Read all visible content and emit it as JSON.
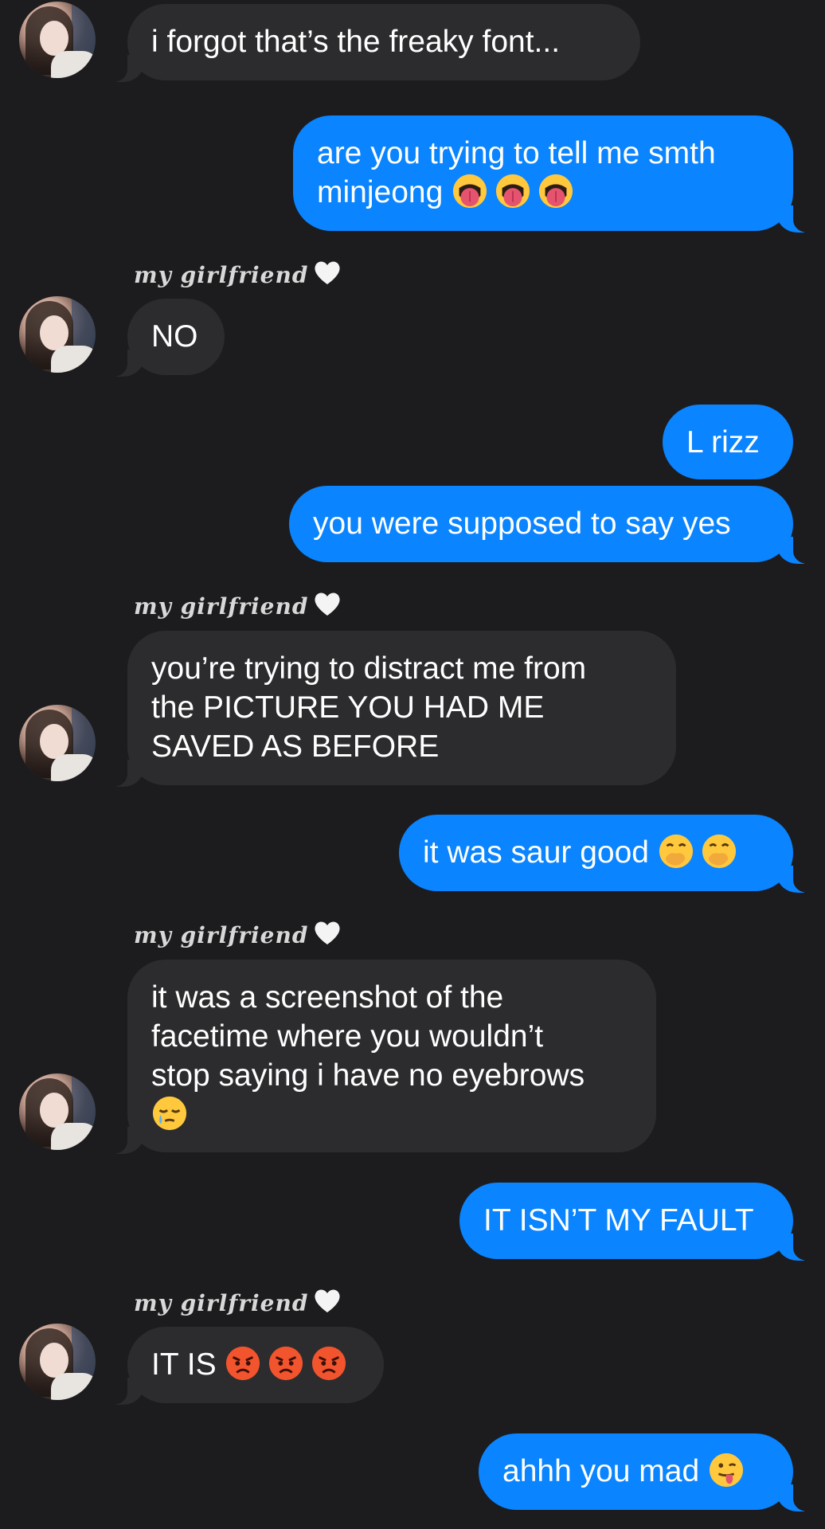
{
  "conversation": {
    "sender_name": "my girlfriend",
    "sender_emoji_icon": "white-heart-icon",
    "messages": [
      {
        "id": 1,
        "direction": "incoming",
        "text": "i forgot that’s the freaky font...",
        "emojis": []
      },
      {
        "id": 2,
        "direction": "outgoing",
        "line1": "are you trying to tell me smth",
        "line2": "minjeong",
        "emojis": [
          "tongue-face-icon",
          "tongue-face-icon",
          "tongue-face-icon"
        ]
      },
      {
        "id": 3,
        "direction": "incoming",
        "text": "NO",
        "emojis": []
      },
      {
        "id": 4,
        "direction": "outgoing",
        "text": "L rizz",
        "emojis": []
      },
      {
        "id": 5,
        "direction": "outgoing",
        "text": "you were supposed to say yes",
        "emojis": []
      },
      {
        "id": 6,
        "direction": "incoming",
        "line1": "you’re trying to distract me from",
        "line2": "the PICTURE YOU HAD ME",
        "line3": "SAVED AS BEFORE",
        "emojis": []
      },
      {
        "id": 7,
        "direction": "outgoing",
        "text": "it was saur good",
        "emojis": [
          "hand-over-mouth-icon",
          "hand-over-mouth-icon"
        ]
      },
      {
        "id": 8,
        "direction": "incoming",
        "line1": "it was a screenshot of the",
        "line2": "facetime where you wouldn’t",
        "line3": "stop saying i have no eyebrows",
        "emojis": [
          "sleepy-face-icon"
        ]
      },
      {
        "id": 9,
        "direction": "outgoing",
        "text": "IT ISN’T MY FAULT",
        "emojis": []
      },
      {
        "id": 10,
        "direction": "incoming",
        "text": "IT IS",
        "emojis": [
          "angry-face-icon",
          "angry-face-icon",
          "angry-face-icon"
        ]
      },
      {
        "id": 11,
        "direction": "outgoing",
        "text": "ahhh you mad",
        "emojis": [
          "tongue-out-face-icon"
        ]
      }
    ]
  },
  "colors": {
    "background": "#1c1c1e",
    "incoming_bubble": "#2c2c2e",
    "outgoing_bubble": "#0a84ff",
    "text": "#ffffff"
  }
}
